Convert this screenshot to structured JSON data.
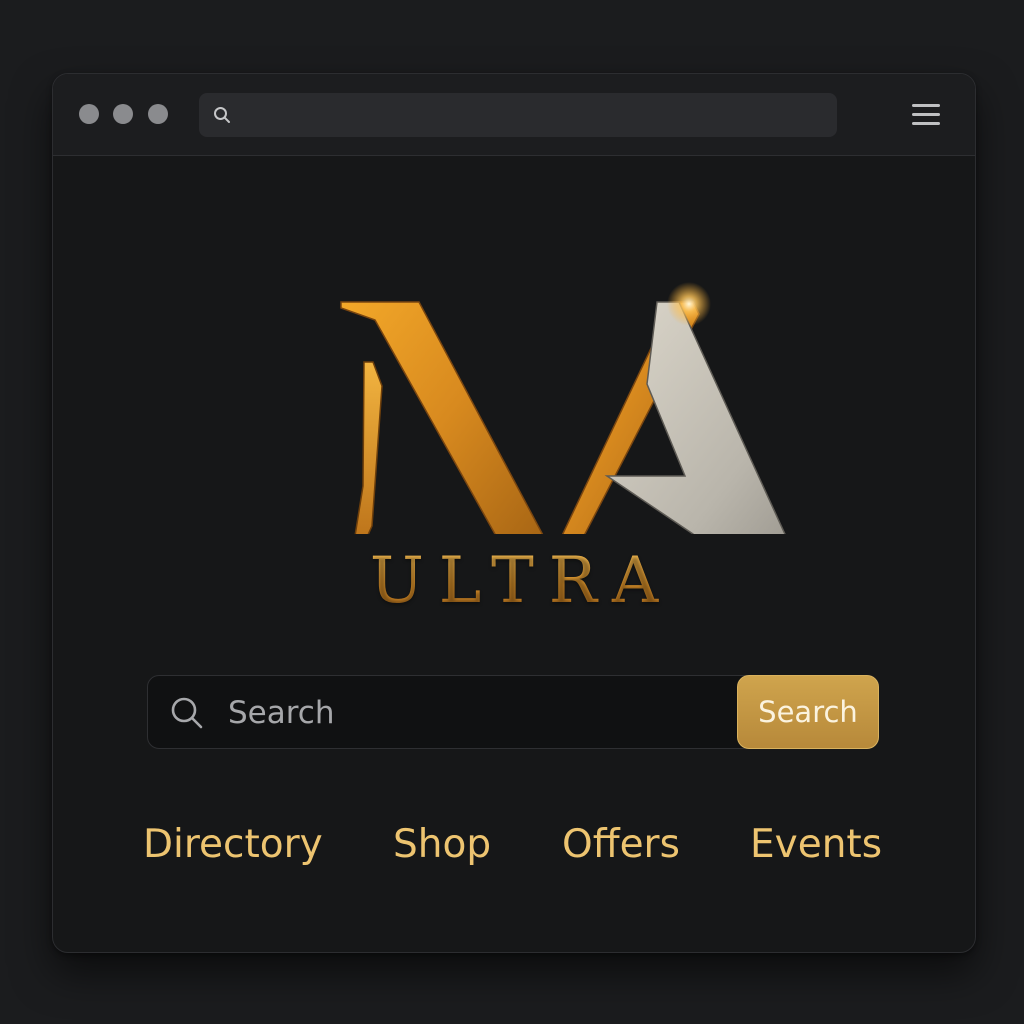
{
  "browser": {
    "window_controls": [
      "dot",
      "dot",
      "dot"
    ],
    "address_bar": {
      "icon": "search-icon",
      "value": ""
    },
    "menu": {
      "icon": "hamburger-menu-icon"
    }
  },
  "brand": {
    "logo": "MA monogram",
    "name": "ULTRA"
  },
  "search": {
    "icon": "search-icon",
    "placeholder": "Search",
    "button_label": "Search"
  },
  "nav": {
    "items": [
      {
        "label": "Directory"
      },
      {
        "label": "Shop"
      },
      {
        "label": "Offers"
      },
      {
        "label": "Events"
      }
    ]
  },
  "colors": {
    "background": "#1b1c1e",
    "window": "#161718",
    "accent_gold": "#edc470",
    "button_gold": "#c49843",
    "silver": "#bdbab2"
  }
}
